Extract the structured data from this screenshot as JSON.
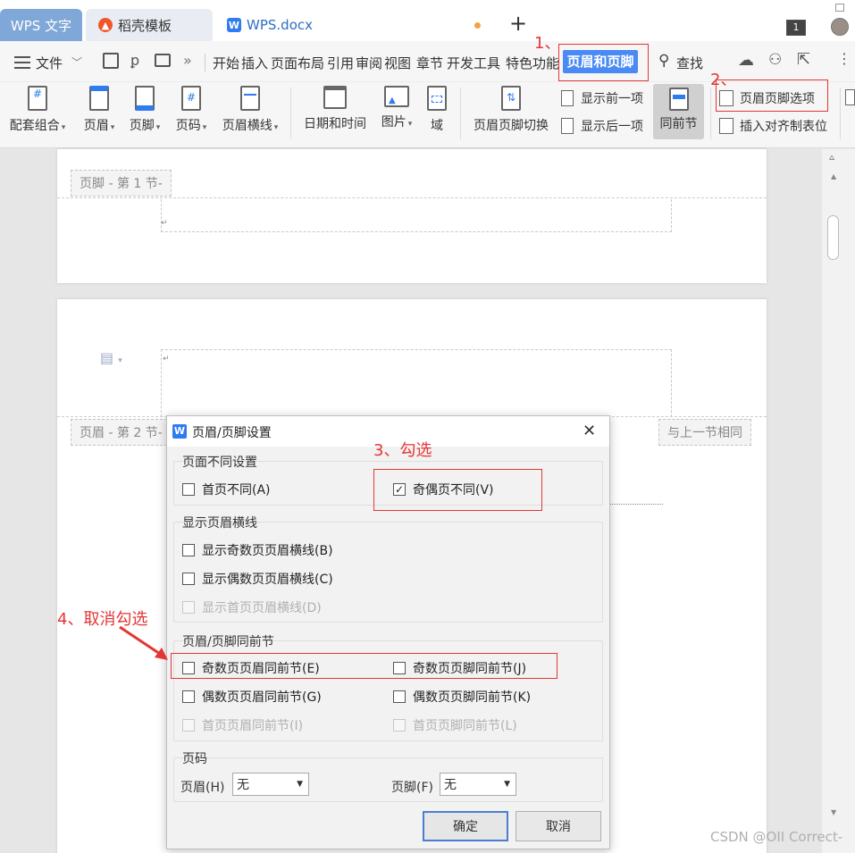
{
  "tabs": {
    "wps_text": "WPS 文字",
    "template": "稻壳模板",
    "document": "WPS.docx",
    "new_tab": "+",
    "window_count": "1"
  },
  "menu": {
    "file": "文件",
    "items": [
      "开始",
      "插入",
      "页面布局",
      "引用",
      "审阅",
      "视图",
      "章节",
      "开发工具",
      "特色功能"
    ],
    "active": "页眉和页脚",
    "search": "查找"
  },
  "ribbon": {
    "combo": "配套组合",
    "header": "页眉",
    "footer": "页脚",
    "page_num": "页码",
    "header_line": "页眉横线",
    "datetime": "日期和时间",
    "picture": "图片",
    "field": "域",
    "switch": "页眉页脚切换",
    "show_prev": "显示前一项",
    "show_next": "显示后一项",
    "same_as_prev": "同前节",
    "hf_options": "页眉页脚选项",
    "insert_tab": "插入对齐制表位"
  },
  "document": {
    "footer_tag": "页脚 - 第 1 节-",
    "header_tag": "页眉 - 第 2 节-",
    "same_as_prev_tag": "与上一节相同"
  },
  "dialog": {
    "title": "页眉/页脚设置",
    "group_diff": "页面不同设置",
    "first_page_diff": "首页不同(A)",
    "odd_even_diff": "奇偶页不同(V)",
    "group_lines": "显示页眉横线",
    "show_odd_line": "显示奇数页页眉横线(B)",
    "show_even_line": "显示偶数页页眉横线(C)",
    "show_first_line": "显示首页页眉横线(D)",
    "group_same": "页眉/页脚同前节",
    "odd_header_same": "奇数页页眉同前节(E)",
    "odd_footer_same": "奇数页页脚同前节(J)",
    "even_header_same": "偶数页页眉同前节(G)",
    "even_footer_same": "偶数页页脚同前节(K)",
    "first_header_same": "首页页眉同前节(I)",
    "first_footer_same": "首页页脚同前节(L)",
    "group_pagenum": "页码",
    "header_label": "页眉(H)",
    "header_value": "无",
    "footer_label": "页脚(F)",
    "footer_value": "无",
    "ok": "确定",
    "cancel": "取消"
  },
  "annotations": {
    "step1": "1、",
    "step2": "2、",
    "step3": "3、勾选",
    "step4": "4、取消勾选"
  },
  "watermark": "CSDN @OII Correct-",
  "colors": {
    "accent": "#4a8af4",
    "annotation": "#e53535"
  }
}
